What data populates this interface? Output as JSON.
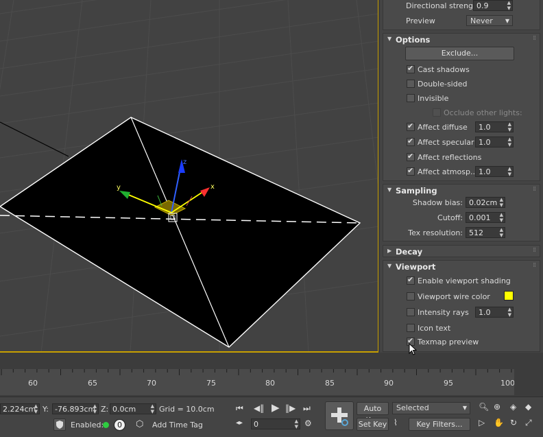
{
  "panel": {
    "params": {
      "directional_strength_label": "Directional strength",
      "directional_strength_value": "0.9",
      "preview_label": "Preview",
      "preview_value": "Never"
    },
    "options": {
      "title": "Options",
      "exclude_button": "Exclude...",
      "cast_shadows": {
        "label": "Cast shadows",
        "checked": true
      },
      "double_sided": {
        "label": "Double-sided",
        "checked": false
      },
      "invisible": {
        "label": "Invisible",
        "checked": false
      },
      "occlude_other_lights": {
        "label": "Occlude other lights:",
        "checked": false
      },
      "affect_diffuse": {
        "label": "Affect diffuse",
        "checked": true,
        "value": "1.0"
      },
      "affect_specular": {
        "label": "Affect specular",
        "checked": true,
        "value": "1.0"
      },
      "affect_reflections": {
        "label": "Affect reflections",
        "checked": true
      },
      "affect_atmosp": {
        "label": "Affect atmosp...",
        "checked": true,
        "value": "1.0"
      }
    },
    "sampling": {
      "title": "Sampling",
      "shadow_bias_label": "Shadow bias:",
      "shadow_bias_value": "0.02cm",
      "cutoff_label": "Cutoff:",
      "cutoff_value": "0.001",
      "tex_resolution_label": "Tex resolution:",
      "tex_resolution_value": "512"
    },
    "decay": {
      "title": "Decay"
    },
    "viewport": {
      "title": "Viewport",
      "enable_viewport_shading": {
        "label": "Enable viewport shading",
        "checked": true
      },
      "viewport_wire_color": {
        "label": "Viewport wire color",
        "checked": false,
        "color": "#ffff00"
      },
      "intensity_rays": {
        "label": "Intensity rays",
        "checked": false,
        "value": "1.0"
      },
      "icon_text": {
        "label": "Icon text",
        "checked": false
      },
      "texmap_preview": {
        "label": "Texmap preview",
        "checked": true
      }
    }
  },
  "gizmo": {
    "x_label": "x",
    "y_label": "y",
    "z_label": "z"
  },
  "timeline": {
    "ticks": [
      "60",
      "65",
      "70",
      "75",
      "80",
      "85",
      "90",
      "95",
      "100"
    ]
  },
  "statusbar": {
    "x_value": "2.224cm",
    "y_label": "Y:",
    "y_value": "-76.893cm",
    "z_label": "Z:",
    "z_value": "0.0cm",
    "grid": "Grid = 10.0cm",
    "enabled_label": "Enabled:",
    "enabled_count": "0",
    "add_time_tag": "Add Time Tag",
    "frame_value": "0",
    "auto_key": "Auto Key",
    "set_key": "Set Key",
    "selected": "Selected",
    "key_filters": "Key Filters..."
  }
}
